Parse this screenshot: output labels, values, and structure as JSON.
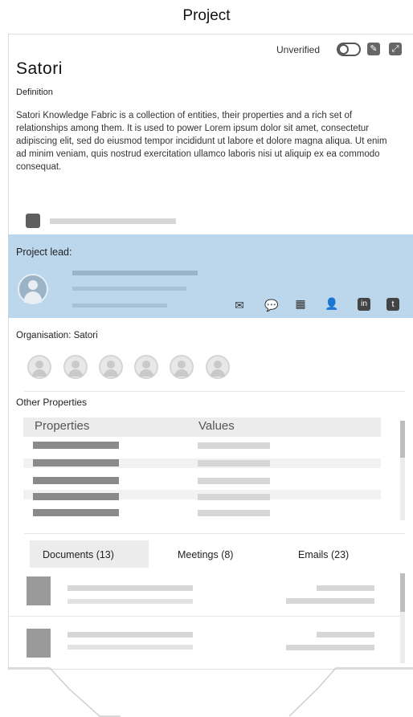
{
  "header": {
    "title": "Project"
  },
  "toolbar": {
    "status": "Unverified",
    "edit_icon": "edit-icon",
    "expand_icon": "expand-icon"
  },
  "entity": {
    "name": "Satori",
    "definition_label": "Definition",
    "definition_text": "Satori Knowledge Fabric is a collection of entities, their properties and a rich set of relationships among them. It is used to power Lorem ipsum dolor sit amet, consectetur adipiscing elit, sed do eiusmod tempor incididunt ut labore et dolore magna aliqua. Ut enim ad minim veniam, quis nostrud exercitation ullamco laboris nisi ut aliquip ex ea commodo consequat."
  },
  "project_lead": {
    "label": "Project lead:",
    "actions": [
      "email-icon",
      "chat-icon",
      "calendar-icon",
      "add-user-icon",
      "linkedin-icon",
      "twitter-icon"
    ],
    "highlight_color": "#bcd6ec"
  },
  "organisation": {
    "label": "Organisation:",
    "value": "Satori",
    "member_count": 6
  },
  "other_properties": {
    "label": "Other Properties",
    "columns": [
      "Properties",
      "Values"
    ]
  },
  "tabs": [
    {
      "label": "Documents (13)",
      "active": true
    },
    {
      "label": "Meetings (8)",
      "active": false
    },
    {
      "label": "Emails (23)",
      "active": false
    }
  ]
}
